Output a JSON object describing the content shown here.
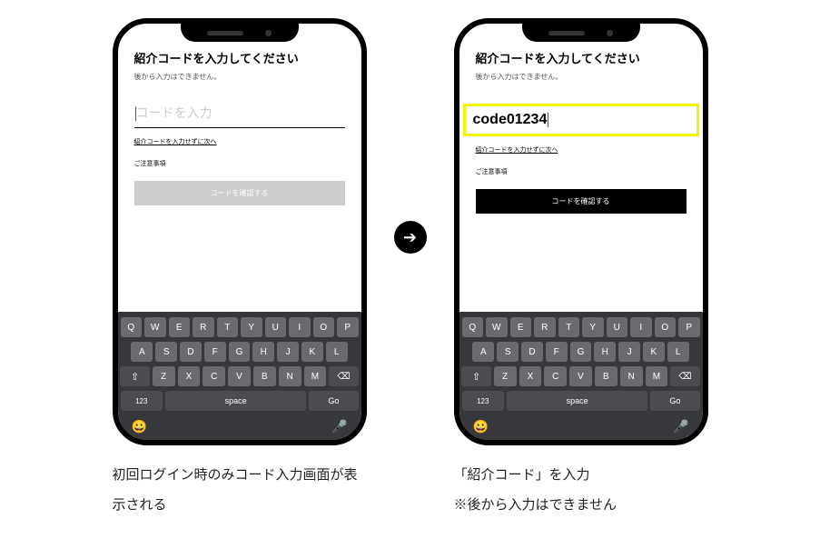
{
  "screen": {
    "title": "紹介コードを入力してください",
    "subtitle": "後から入力はできません。",
    "placeholder": "コードを入力",
    "value": "code01234",
    "skip_label": "紹介コードを入力せずに次へ",
    "notice_label": "ご注意事項",
    "confirm_label": "コードを確認する"
  },
  "keyboard": {
    "row1": [
      "Q",
      "W",
      "E",
      "R",
      "T",
      "Y",
      "U",
      "I",
      "O",
      "P"
    ],
    "row2": [
      "A",
      "S",
      "D",
      "F",
      "G",
      "H",
      "J",
      "K",
      "L"
    ],
    "row3": [
      "Z",
      "X",
      "C",
      "V",
      "B",
      "N",
      "M"
    ],
    "shift": "⇧",
    "backspace": "⌫",
    "num": "123",
    "space": "space",
    "go": "Go",
    "emoji": "😀",
    "mic": "🎤"
  },
  "arrow": "➔",
  "caption1": "初回ログイン時のみコード入力画面が表示される",
  "caption2": "「紹介コード」を入力\n※後から入力はできません"
}
